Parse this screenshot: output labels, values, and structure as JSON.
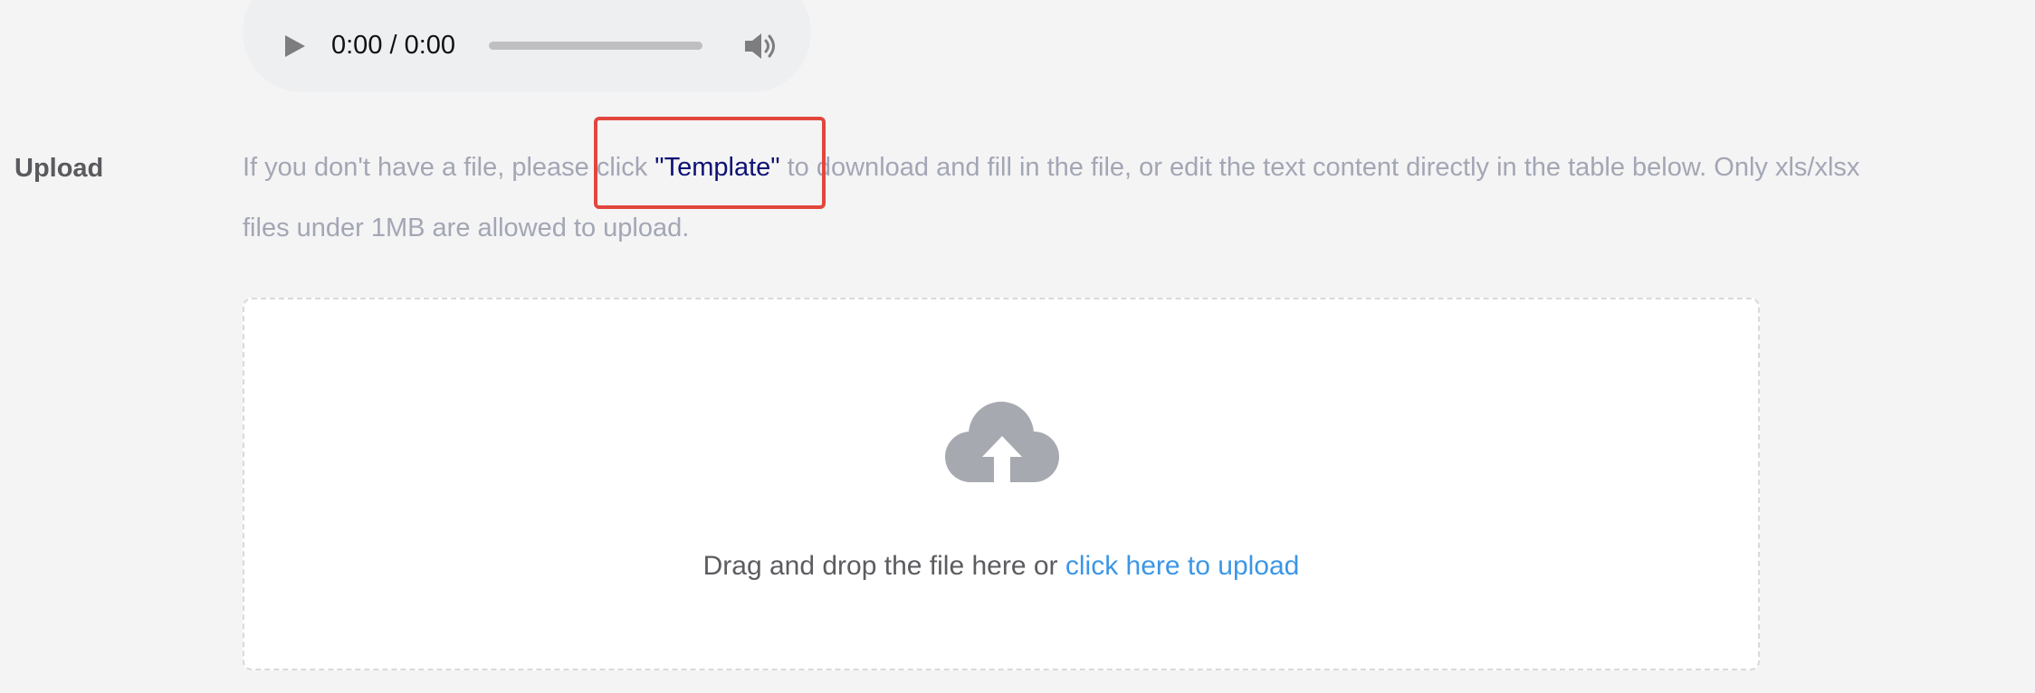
{
  "audio": {
    "time": "0:00 / 0:00",
    "play_icon": "play-icon",
    "volume_icon": "volume-icon"
  },
  "upload": {
    "label": "Upload",
    "desc_before": "If you don't have a file, please click ",
    "template_link": "\"Template\"",
    "desc_after": " to download and fill in the file, or edit the text content directly in the table below. Only xls/xlsx files under 1MB are allowed to upload."
  },
  "dropzone": {
    "icon": "cloud-upload-icon",
    "text": "Drag and drop the file here or ",
    "link": "click here to upload"
  },
  "colors": {
    "link_blue": "#3c96e6",
    "template_link": "#0d1173",
    "highlight": "#e2473d",
    "muted_text": "#a3a6b4",
    "icon_gray": "#a7a9b0"
  }
}
